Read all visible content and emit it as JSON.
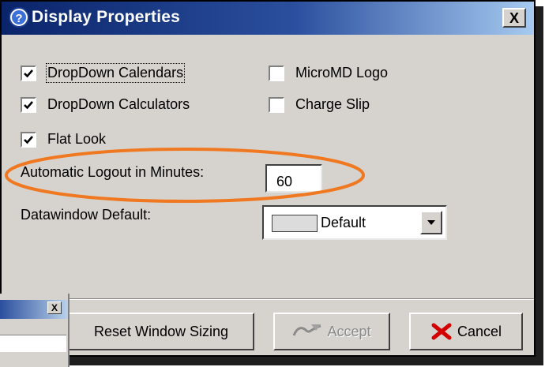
{
  "window": {
    "title": "Display Properties",
    "close_label": "X"
  },
  "checkboxes": [
    {
      "label": "DropDown Calendars",
      "checked": true
    },
    {
      "label": "DropDown Calculators",
      "checked": true
    },
    {
      "label": "Flat Look",
      "checked": true
    },
    {
      "label": "MicroMD Logo",
      "checked": false
    },
    {
      "label": "Charge Slip",
      "checked": false
    }
  ],
  "logout": {
    "label": "Automatic Logout in Minutes:",
    "value": "60"
  },
  "datawindow": {
    "label": "Datawindow Default:",
    "selected": "Default"
  },
  "buttons": {
    "reset": "Reset Window Sizing",
    "accept": "Accept",
    "cancel": "Cancel"
  },
  "background_window": {
    "close_label": "X"
  },
  "colors": {
    "dialog_bg": "#d6d3ce",
    "title_start": "#0a246a",
    "highlight": "#f07820",
    "cancel_icon": "#d40000"
  },
  "icons": [
    "help-icon",
    "close-icon",
    "check-icon",
    "chevron-down-icon",
    "accept-pen-icon",
    "cancel-x-icon"
  ]
}
